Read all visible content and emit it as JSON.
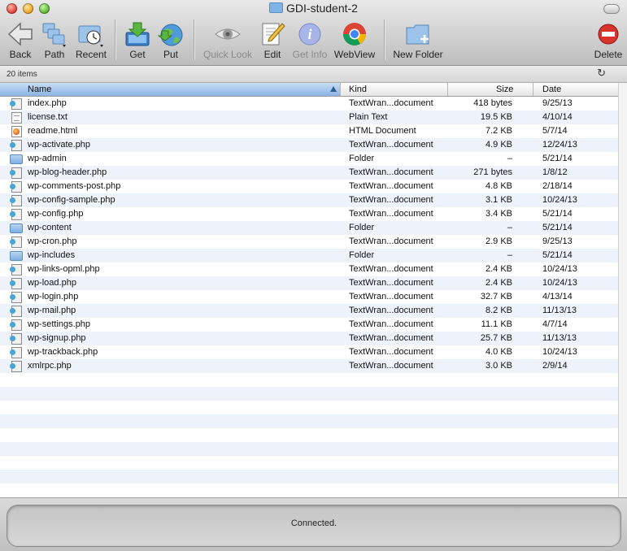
{
  "window": {
    "title": "GDI-student-2"
  },
  "toolbar": {
    "back": "Back",
    "path": "Path",
    "recent": "Recent",
    "get": "Get",
    "put": "Put",
    "quicklook": "Quick Look",
    "edit": "Edit",
    "getinfo": "Get Info",
    "webview": "WebView",
    "newfolder": "New Folder",
    "delete": "Delete"
  },
  "infobar": {
    "count": "20 items"
  },
  "columns": {
    "name": "Name",
    "kind": "Kind",
    "size": "Size",
    "date": "Date"
  },
  "files": [
    {
      "name": "index.php",
      "kind": "TextWran...document",
      "size": "418 bytes",
      "date": "9/25/13",
      "icon": "php-file-icon"
    },
    {
      "name": "license.txt",
      "kind": "Plain Text",
      "size": "19.5 KB",
      "date": "4/10/14",
      "icon": "text-file-icon"
    },
    {
      "name": "readme.html",
      "kind": "HTML Document",
      "size": "7.2 KB",
      "date": "5/7/14",
      "icon": "html-file-icon"
    },
    {
      "name": "wp-activate.php",
      "kind": "TextWran...document",
      "size": "4.9 KB",
      "date": "12/24/13",
      "icon": "php-file-icon"
    },
    {
      "name": "wp-admin",
      "kind": "Folder",
      "size": "–",
      "date": "5/21/14",
      "icon": "folder-icon"
    },
    {
      "name": "wp-blog-header.php",
      "kind": "TextWran...document",
      "size": "271 bytes",
      "date": "1/8/12",
      "icon": "php-file-icon"
    },
    {
      "name": "wp-comments-post.php",
      "kind": "TextWran...document",
      "size": "4.8 KB",
      "date": "2/18/14",
      "icon": "php-file-icon"
    },
    {
      "name": "wp-config-sample.php",
      "kind": "TextWran...document",
      "size": "3.1 KB",
      "date": "10/24/13",
      "icon": "php-file-icon"
    },
    {
      "name": "wp-config.php",
      "kind": "TextWran...document",
      "size": "3.4 KB",
      "date": "5/21/14",
      "icon": "php-file-icon"
    },
    {
      "name": "wp-content",
      "kind": "Folder",
      "size": "–",
      "date": "5/21/14",
      "icon": "folder-icon"
    },
    {
      "name": "wp-cron.php",
      "kind": "TextWran...document",
      "size": "2.9 KB",
      "date": "9/25/13",
      "icon": "php-file-icon"
    },
    {
      "name": "wp-includes",
      "kind": "Folder",
      "size": "–",
      "date": "5/21/14",
      "icon": "folder-icon"
    },
    {
      "name": "wp-links-opml.php",
      "kind": "TextWran...document",
      "size": "2.4 KB",
      "date": "10/24/13",
      "icon": "php-file-icon"
    },
    {
      "name": "wp-load.php",
      "kind": "TextWran...document",
      "size": "2.4 KB",
      "date": "10/24/13",
      "icon": "php-file-icon"
    },
    {
      "name": "wp-login.php",
      "kind": "TextWran...document",
      "size": "32.7 KB",
      "date": "4/13/14",
      "icon": "php-file-icon"
    },
    {
      "name": "wp-mail.php",
      "kind": "TextWran...document",
      "size": "8.2 KB",
      "date": "11/13/13",
      "icon": "php-file-icon"
    },
    {
      "name": "wp-settings.php",
      "kind": "TextWran...document",
      "size": "11.1 KB",
      "date": "4/7/14",
      "icon": "php-file-icon"
    },
    {
      "name": "wp-signup.php",
      "kind": "TextWran...document",
      "size": "25.7 KB",
      "date": "11/13/13",
      "icon": "php-file-icon"
    },
    {
      "name": "wp-trackback.php",
      "kind": "TextWran...document",
      "size": "4.0 KB",
      "date": "10/24/13",
      "icon": "php-file-icon"
    },
    {
      "name": "xmlrpc.php",
      "kind": "TextWran...document",
      "size": "3.0 KB",
      "date": "2/9/14",
      "icon": "php-file-icon"
    }
  ],
  "status": {
    "text": "Connected."
  }
}
